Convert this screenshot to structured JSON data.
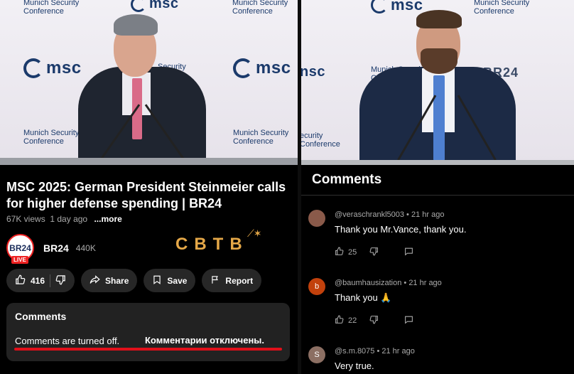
{
  "video_left": {
    "msc_label_top": "Munich Security Conference",
    "msc_logo": "msc",
    "msc_label_mid": "Munich Security Conference",
    "msc_label_right": "Munich Security Conference",
    "security_fragment": "Security"
  },
  "video_right": {
    "msc_logo": "msc",
    "msc_label_top": "Munich Security Conference",
    "msc_label_mid": "Munich Security Conference",
    "br24_tag": "BR24",
    "partial_logo": "nsc",
    "partial_security": "ecurity Conference"
  },
  "video": {
    "title": "MSC 2025: German President Steinmeier calls for higher defense spending | BR24",
    "views": "67K views",
    "age": "1 day ago",
    "more": "...more"
  },
  "channel": {
    "avatar_text": "BR24",
    "live_badge": "LIVE",
    "name": "BR24",
    "subscribers": "440K"
  },
  "watermark": {
    "text": "CBTB"
  },
  "actions": {
    "likes": "416",
    "share": "Share",
    "save": "Save",
    "report": "Report",
    "icons": [
      "thumbs-up-icon",
      "thumbs-down-icon",
      "share-icon",
      "bookmark-icon",
      "flag-icon"
    ]
  },
  "comments_off_panel": {
    "heading": "Comments",
    "message": "Comments are turned off.",
    "translation": "Комментарии отключены."
  },
  "comments_panel": {
    "heading": "Comments",
    "items": [
      {
        "author": "@veraschrankl5003",
        "time": "21 hr ago",
        "text": "Thank you Mr.Vance, thank you.",
        "likes": "25",
        "avatar_letter": "",
        "avatar_color": "#8a5a4a"
      },
      {
        "author": "@baumhausization",
        "time": "21 hr ago",
        "text": "Thank you 🙏",
        "likes": "22",
        "avatar_letter": "b",
        "avatar_color": "#c2410c"
      },
      {
        "author": "@s.m.8075",
        "time": "21 hr ago",
        "text": "Very true.",
        "likes": "",
        "avatar_letter": "S",
        "avatar_color": "#8c6f63"
      }
    ]
  },
  "colors": {
    "accent_red": "#e0101a",
    "msc_blue": "#1b3a6b",
    "watermark_gold": "#e5a848"
  }
}
